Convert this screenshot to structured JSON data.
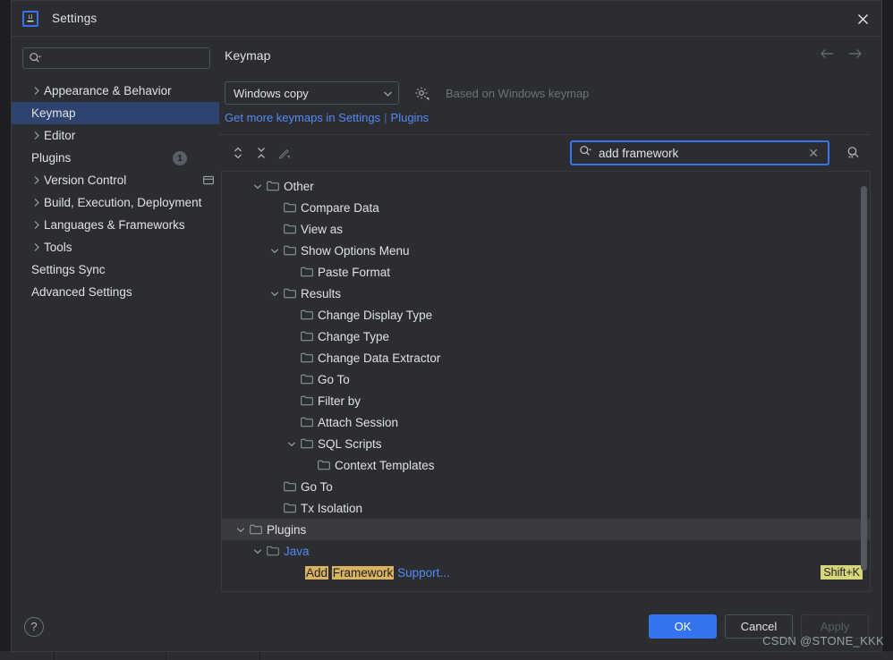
{
  "window": {
    "title": "Settings",
    "logo_icon": "intellij-idea-logo-icon",
    "close_icon": "close-icon"
  },
  "sidebar": {
    "search": {
      "placeholder": "",
      "value": "",
      "icon": "search-icon"
    },
    "items": [
      {
        "label": "Appearance & Behavior",
        "arrow": true,
        "selected": false
      },
      {
        "label": "Keymap",
        "arrow": false,
        "selected": true
      },
      {
        "label": "Editor",
        "arrow": true,
        "selected": false
      },
      {
        "label": "Plugins",
        "arrow": false,
        "selected": false,
        "badge": "1"
      },
      {
        "label": "Version Control",
        "arrow": true,
        "selected": false,
        "trailing_icon": "project-scope-icon"
      },
      {
        "label": "Build, Execution, Deployment",
        "arrow": true,
        "selected": false
      },
      {
        "label": "Languages & Frameworks",
        "arrow": true,
        "selected": false
      },
      {
        "label": "Tools",
        "arrow": true,
        "selected": false
      },
      {
        "label": "Settings Sync",
        "arrow": false,
        "selected": false
      },
      {
        "label": "Advanced Settings",
        "arrow": false,
        "selected": false
      }
    ]
  },
  "main": {
    "title": "Keymap",
    "nav_back_icon": "arrow-left-icon",
    "nav_forward_icon": "arrow-right-icon",
    "keymap_select": {
      "value": "Windows copy",
      "chevron_icon": "chevron-down-icon"
    },
    "gear_icon": "gear-icon",
    "based_on": "Based on Windows keymap",
    "links": {
      "get_more": "Get more keymaps in Settings",
      "separator": "|",
      "plugins": "Plugins"
    },
    "toolbar": {
      "expand_icon": "expand-all-icon",
      "collapse_icon": "collapse-all-icon",
      "edit_icon": "edit-pencil-icon"
    },
    "search": {
      "value": "add framework",
      "search_icon": "search-icon",
      "clear_icon": "clear-x-icon",
      "filter_icon": "find-shortcut-icon"
    }
  },
  "tree": {
    "rows": [
      {
        "label": "Other",
        "indent": 1,
        "chevron": "down",
        "folder": true
      },
      {
        "label": "Compare Data",
        "indent": 2,
        "chevron": "",
        "folder": true
      },
      {
        "label": "View as",
        "indent": 2,
        "chevron": "",
        "folder": true
      },
      {
        "label": "Show Options Menu",
        "indent": 2,
        "chevron": "down",
        "folder": true
      },
      {
        "label": "Paste Format",
        "indent": 3,
        "chevron": "",
        "folder": true
      },
      {
        "label": "Results",
        "indent": 2,
        "chevron": "down",
        "folder": true
      },
      {
        "label": "Change Display Type",
        "indent": 3,
        "chevron": "",
        "folder": true
      },
      {
        "label": "Change Type",
        "indent": 3,
        "chevron": "",
        "folder": true
      },
      {
        "label": "Change Data Extractor",
        "indent": 3,
        "chevron": "",
        "folder": true
      },
      {
        "label": "Go To",
        "indent": 3,
        "chevron": "",
        "folder": true
      },
      {
        "label": "Filter by",
        "indent": 3,
        "chevron": "",
        "folder": true
      },
      {
        "label": "Attach Session",
        "indent": 3,
        "chevron": "",
        "folder": true
      },
      {
        "label": "SQL Scripts",
        "indent": 3,
        "chevron": "down",
        "folder": true
      },
      {
        "label": "Context Templates",
        "indent": 4,
        "chevron": "",
        "folder": true
      },
      {
        "label": "Go To",
        "indent": 2,
        "chevron": "",
        "folder": true
      },
      {
        "label": "Tx Isolation",
        "indent": 2,
        "chevron": "",
        "folder": true
      },
      {
        "label": "Plugins",
        "indent": 0,
        "chevron": "down",
        "folder": true,
        "highlight": true
      },
      {
        "label": "Java",
        "indent": 1,
        "chevron": "down",
        "folder": true,
        "blue": true
      },
      {
        "label": "",
        "indent": 3,
        "chevron": "",
        "folder": false,
        "parts": [
          {
            "text": "Add",
            "match": true
          },
          {
            "text": " ",
            "match": false
          },
          {
            "text": "Framework",
            "match": true
          },
          {
            "text": " Support...",
            "match": false
          }
        ],
        "shortcut": "Shift+K"
      }
    ]
  },
  "footer": {
    "help_label": "?",
    "ok": "OK",
    "cancel": "Cancel",
    "apply": "Apply"
  },
  "watermark": "CSDN @STONE_KKK",
  "colors": {
    "accent": "#3574f0",
    "link": "#548af7",
    "selection": "#2e436e",
    "match_highlight": "#d9b360",
    "shortcut_highlight": "#d6d77a",
    "panel_bg": "#2b2d30",
    "border": "#393b40"
  }
}
